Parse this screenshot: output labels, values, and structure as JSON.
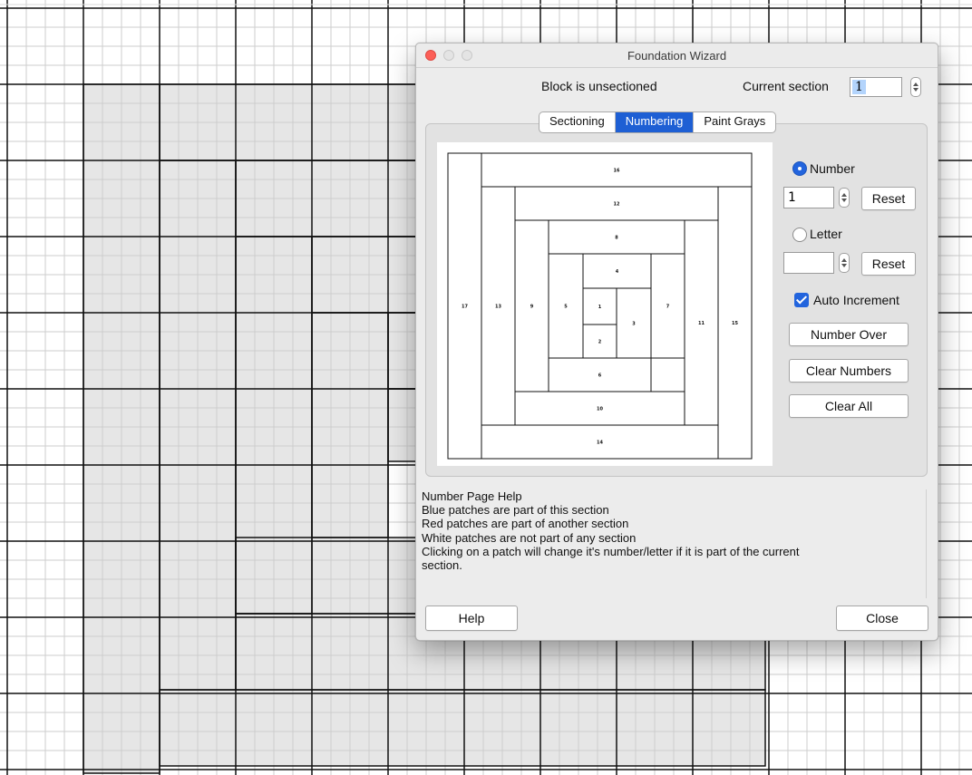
{
  "window": {
    "title": "Foundation Wizard"
  },
  "header": {
    "status": "Block is unsectioned",
    "current_section_label": "Current section",
    "current_section_value": "1"
  },
  "tabs": [
    {
      "label": "Sectioning"
    },
    {
      "label": "Numbering"
    },
    {
      "label": "Paint Grays"
    }
  ],
  "number_panel": {
    "number_label": "Number",
    "number_value": "1",
    "letter_label": "Letter",
    "letter_value": "",
    "reset_label": "Reset",
    "auto_increment_label": "Auto Increment",
    "number_over_label": "Number Over",
    "clear_numbers_label": "Clear Numbers",
    "clear_all_label": "Clear All"
  },
  "block_numbers": [
    "1",
    "2",
    "3",
    "4",
    "5",
    "6",
    "7",
    "8",
    "9",
    "10",
    "11",
    "12",
    "13",
    "14",
    "15",
    "16",
    "17"
  ],
  "help": {
    "lines": [
      "Number Page Help",
      "Blue patches are part of this section",
      "Red patches are part of another section",
      "White patches are not part of any section",
      "Clicking on a patch will change it's number/letter if it is part of the current",
      "section."
    ]
  },
  "footer": {
    "help_label": "Help",
    "close_label": "Close"
  },
  "colors": {
    "accent": "#1e5fd4",
    "patch_gray": "#e6e6e6",
    "close_red": "#fc5f57"
  }
}
